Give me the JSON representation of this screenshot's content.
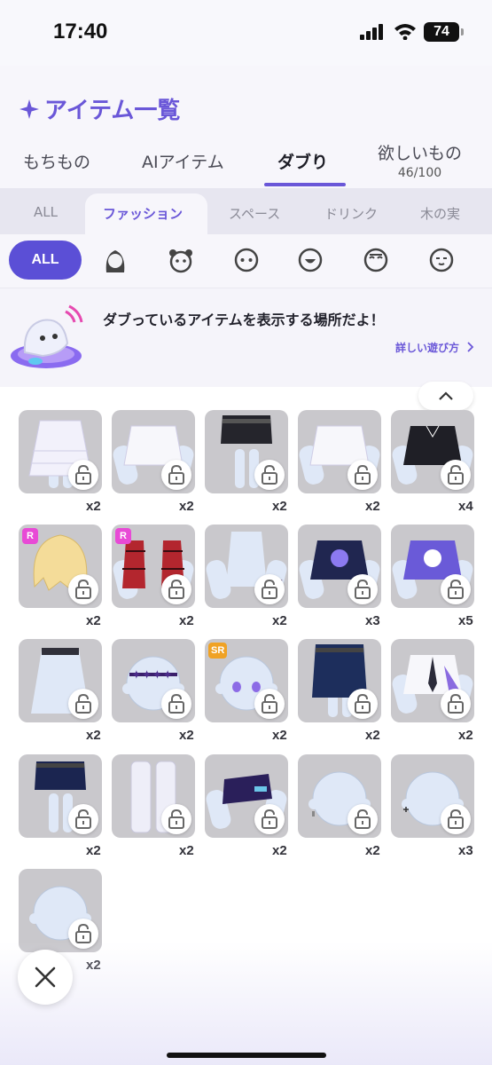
{
  "status_bar": {
    "time": "17:40",
    "battery": "74"
  },
  "header": {
    "title": "アイテム一覧"
  },
  "tabs": [
    {
      "label": "もちもの"
    },
    {
      "label": "AIアイテム"
    },
    {
      "label": "ダブり",
      "active": true
    },
    {
      "label": "欲しいもの",
      "sub": "46/100"
    }
  ],
  "subtabs": [
    {
      "label": "ALL"
    },
    {
      "label": "ファッション",
      "active": true
    },
    {
      "label": "スペース"
    },
    {
      "label": "ドリンク"
    },
    {
      "label": "木の実"
    }
  ],
  "filters": {
    "all_label": "ALL",
    "faces": [
      "hair-icon",
      "animal-face-icon",
      "eyes-icon",
      "mouth-icon",
      "sleepy-face-icon",
      "calm-face-icon"
    ]
  },
  "banner": {
    "message": "ダブっているアイテムを表示する場所だよ！",
    "link": "詳しい遊び方"
  },
  "items": [
    {
      "count": "x2",
      "kind": "skirt",
      "rarity": ""
    },
    {
      "count": "x2",
      "kind": "top-white",
      "rarity": ""
    },
    {
      "count": "x2",
      "kind": "shorts-black",
      "rarity": ""
    },
    {
      "count": "x2",
      "kind": "top-white",
      "rarity": ""
    },
    {
      "count": "x4",
      "kind": "top-black",
      "rarity": ""
    },
    {
      "count": "x2",
      "kind": "hair-blonde",
      "rarity": "R"
    },
    {
      "count": "x2",
      "kind": "jacket-red",
      "rarity": "R"
    },
    {
      "count": "x2",
      "kind": "tail",
      "rarity": ""
    },
    {
      "count": "x3",
      "kind": "top-navy",
      "rarity": ""
    },
    {
      "count": "x5",
      "kind": "top-purple",
      "rarity": ""
    },
    {
      "count": "x2",
      "kind": "skirt-plain",
      "rarity": ""
    },
    {
      "count": "x2",
      "kind": "head-stars",
      "rarity": ""
    },
    {
      "count": "x2",
      "kind": "head-eyes",
      "rarity": "SR"
    },
    {
      "count": "x2",
      "kind": "shorts-denim",
      "rarity": ""
    },
    {
      "count": "x2",
      "kind": "top-tie",
      "rarity": ""
    },
    {
      "count": "x2",
      "kind": "shorts-navy",
      "rarity": ""
    },
    {
      "count": "x2",
      "kind": "socks",
      "rarity": ""
    },
    {
      "count": "x2",
      "kind": "top-crop",
      "rarity": ""
    },
    {
      "count": "x2",
      "kind": "head-earring",
      "rarity": ""
    },
    {
      "count": "x3",
      "kind": "head-cross",
      "rarity": ""
    },
    {
      "count": "x2",
      "kind": "head-plain",
      "rarity": ""
    }
  ],
  "colors": {
    "accent": "#6a57d8",
    "chip": "#5b4fd6",
    "tile": "#c9c8cc",
    "rarity_r": "#e84ad6",
    "rarity_sr": "#f0a224"
  }
}
